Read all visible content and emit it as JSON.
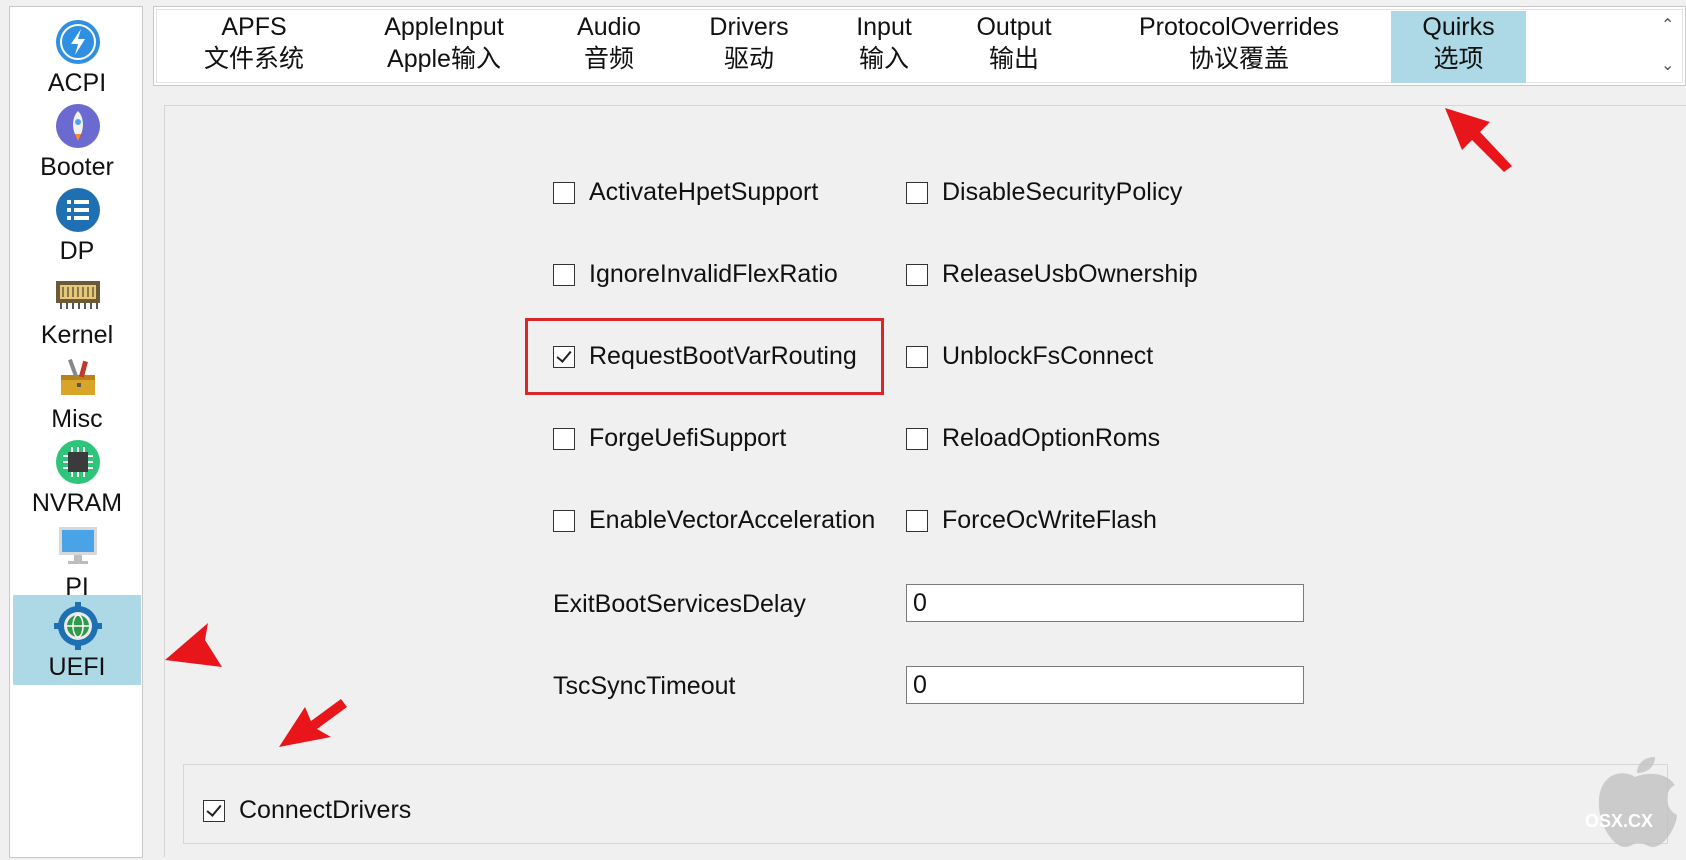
{
  "sidebar": {
    "items": [
      {
        "label": "ACPI",
        "icon": "lightning-icon"
      },
      {
        "label": "Booter",
        "icon": "rocket-icon"
      },
      {
        "label": "DP",
        "icon": "list-icon"
      },
      {
        "label": "Kernel",
        "icon": "chip-board-icon"
      },
      {
        "label": "Misc",
        "icon": "toolbox-icon"
      },
      {
        "label": "NVRAM",
        "icon": "processor-icon"
      },
      {
        "label": "PI",
        "icon": "monitor-icon"
      },
      {
        "label": "UEFI",
        "icon": "globe-gear-icon"
      }
    ],
    "selected": "UEFI"
  },
  "tabs": [
    {
      "line1": "APFS",
      "line2": "文件系统"
    },
    {
      "line1": "AppleInput",
      "line2": "Apple输入"
    },
    {
      "line1": "Audio",
      "line2": "音频"
    },
    {
      "line1": "Drivers",
      "line2": "驱动"
    },
    {
      "line1": "Input",
      "line2": "输入"
    },
    {
      "line1": "Output",
      "line2": "输出"
    },
    {
      "line1": "ProtocolOverrides",
      "line2": "协议覆盖"
    },
    {
      "line1": "Quirks",
      "line2": "选项"
    }
  ],
  "active_tab": "Quirks",
  "quirks": {
    "left": [
      {
        "label": "ActivateHpetSupport",
        "checked": false
      },
      {
        "label": "IgnoreInvalidFlexRatio",
        "checked": false
      },
      {
        "label": "RequestBootVarRouting",
        "checked": true
      },
      {
        "label": "ForgeUefiSupport",
        "checked": false
      },
      {
        "label": "EnableVectorAcceleration",
        "checked": false
      }
    ],
    "right": [
      {
        "label": "DisableSecurityPolicy",
        "checked": false
      },
      {
        "label": "ReleaseUsbOwnership",
        "checked": false
      },
      {
        "label": "UnblockFsConnect",
        "checked": false
      },
      {
        "label": "ReloadOptionRoms",
        "checked": false
      },
      {
        "label": "ForceOcWriteFlash",
        "checked": false
      }
    ],
    "fields": [
      {
        "label": "ExitBootServicesDelay",
        "value": "0"
      },
      {
        "label": "TscSyncTimeout",
        "value": "0"
      }
    ]
  },
  "connect_drivers": {
    "label": "ConnectDrivers",
    "checked": true
  },
  "watermark": "OSX.CX",
  "colors": {
    "selected": "#add8e6",
    "highlight": "#d8262b",
    "arrow": "#e8161b"
  }
}
